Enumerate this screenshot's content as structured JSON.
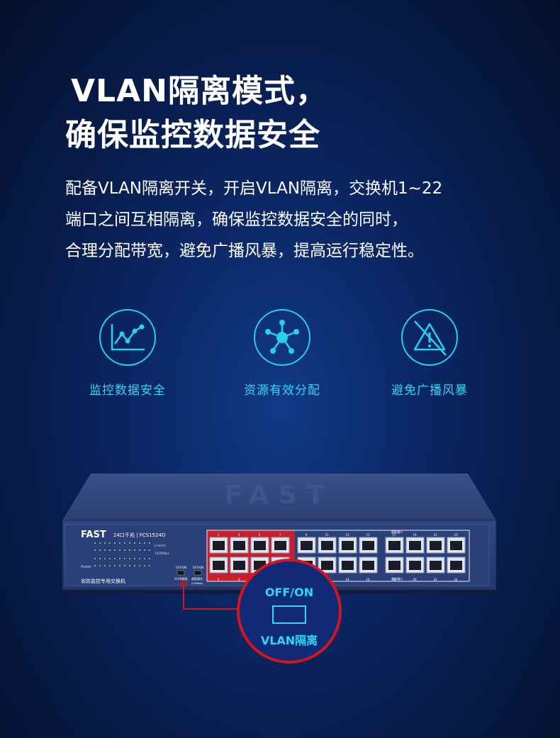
{
  "headline": {
    "line1": "VLAN隔离模式，",
    "line2": "确保监控数据安全"
  },
  "description": {
    "line1": "配备VLAN隔离开关，开启VLAN隔离，交换机1~22",
    "line2": "端口之间互相隔离，确保监控数据安全的同时，",
    "line3": "合理分配带宽，避免广播风暴，提高运行稳定性。"
  },
  "features": [
    {
      "label": "监控数据安全",
      "icon": "line-chart-icon"
    },
    {
      "label": "资源有效分配",
      "icon": "network-hub-icon"
    },
    {
      "label": "避免广播风暴",
      "icon": "warning-triangle-icon"
    }
  ],
  "switch_panel": {
    "brand": "FAST",
    "model": "24口千兆 | FCS1524D",
    "subtitle": "安防监控专用交换机",
    "top_logo": "FAST",
    "vlan_label": "VLAN隔离",
    "mode_label": "超距模式",
    "off_on_small": "OFF/ON",
    "mode_sub": "(10Mbps)",
    "power_label": "Power",
    "link_act": "Link/Act",
    "speed": "1000Mbps",
    "top_port_numbers": [
      "1",
      "3",
      "5",
      "7",
      "9",
      "11",
      "13",
      "15",
      "17",
      "19",
      "21",
      "23"
    ],
    "bottom_port_numbers": [
      "2",
      "4",
      "6",
      "8",
      "10",
      "12",
      "14",
      "16",
      "18",
      "20",
      "22",
      "24"
    ],
    "uplink_top": "超距端口",
    "uplink_bottom": "超距端口",
    "uplink_tag_top": "23(Uplink)",
    "uplink_tag_bottom": "24(Uplink)"
  },
  "callout": {
    "top": "OFF/ON",
    "bottom": "VLAN隔离"
  },
  "colors": {
    "accent": "#2fd6f5",
    "callout_red": "#d3161e",
    "port_red": "#c8202a",
    "switch_body": "#2a3f73"
  }
}
